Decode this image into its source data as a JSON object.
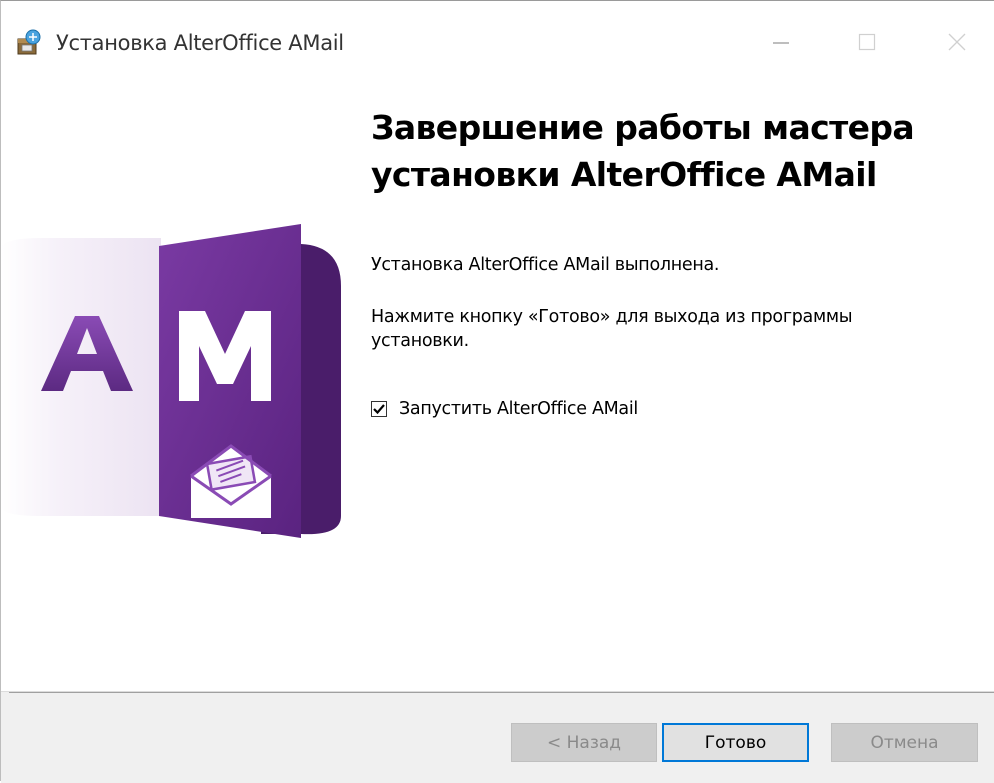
{
  "window": {
    "title": "Установка AlterOffice AMail"
  },
  "main": {
    "heading_line1": "Завершение работы мастера",
    "heading_line2": "установки AlterOffice AMail",
    "status_text": "Установка AlterOffice AMail выполнена.",
    "instruction_text": "Нажмите кнопку «Готово» для выхода из программы установки.",
    "launch_checkbox": {
      "label": "Запустить AlterOffice AMail",
      "checked": true
    }
  },
  "logo": {
    "letters": "AM",
    "colors": {
      "purple": "#6b2d8f",
      "purple_dark": "#4a1d6a",
      "light": "#f3eef6"
    }
  },
  "footer": {
    "back_label": "< Назад",
    "finish_label": "Готово",
    "cancel_label": "Отмена"
  },
  "colors": {
    "accent": "#0078d7",
    "footer_bg": "#f0f0f0"
  }
}
